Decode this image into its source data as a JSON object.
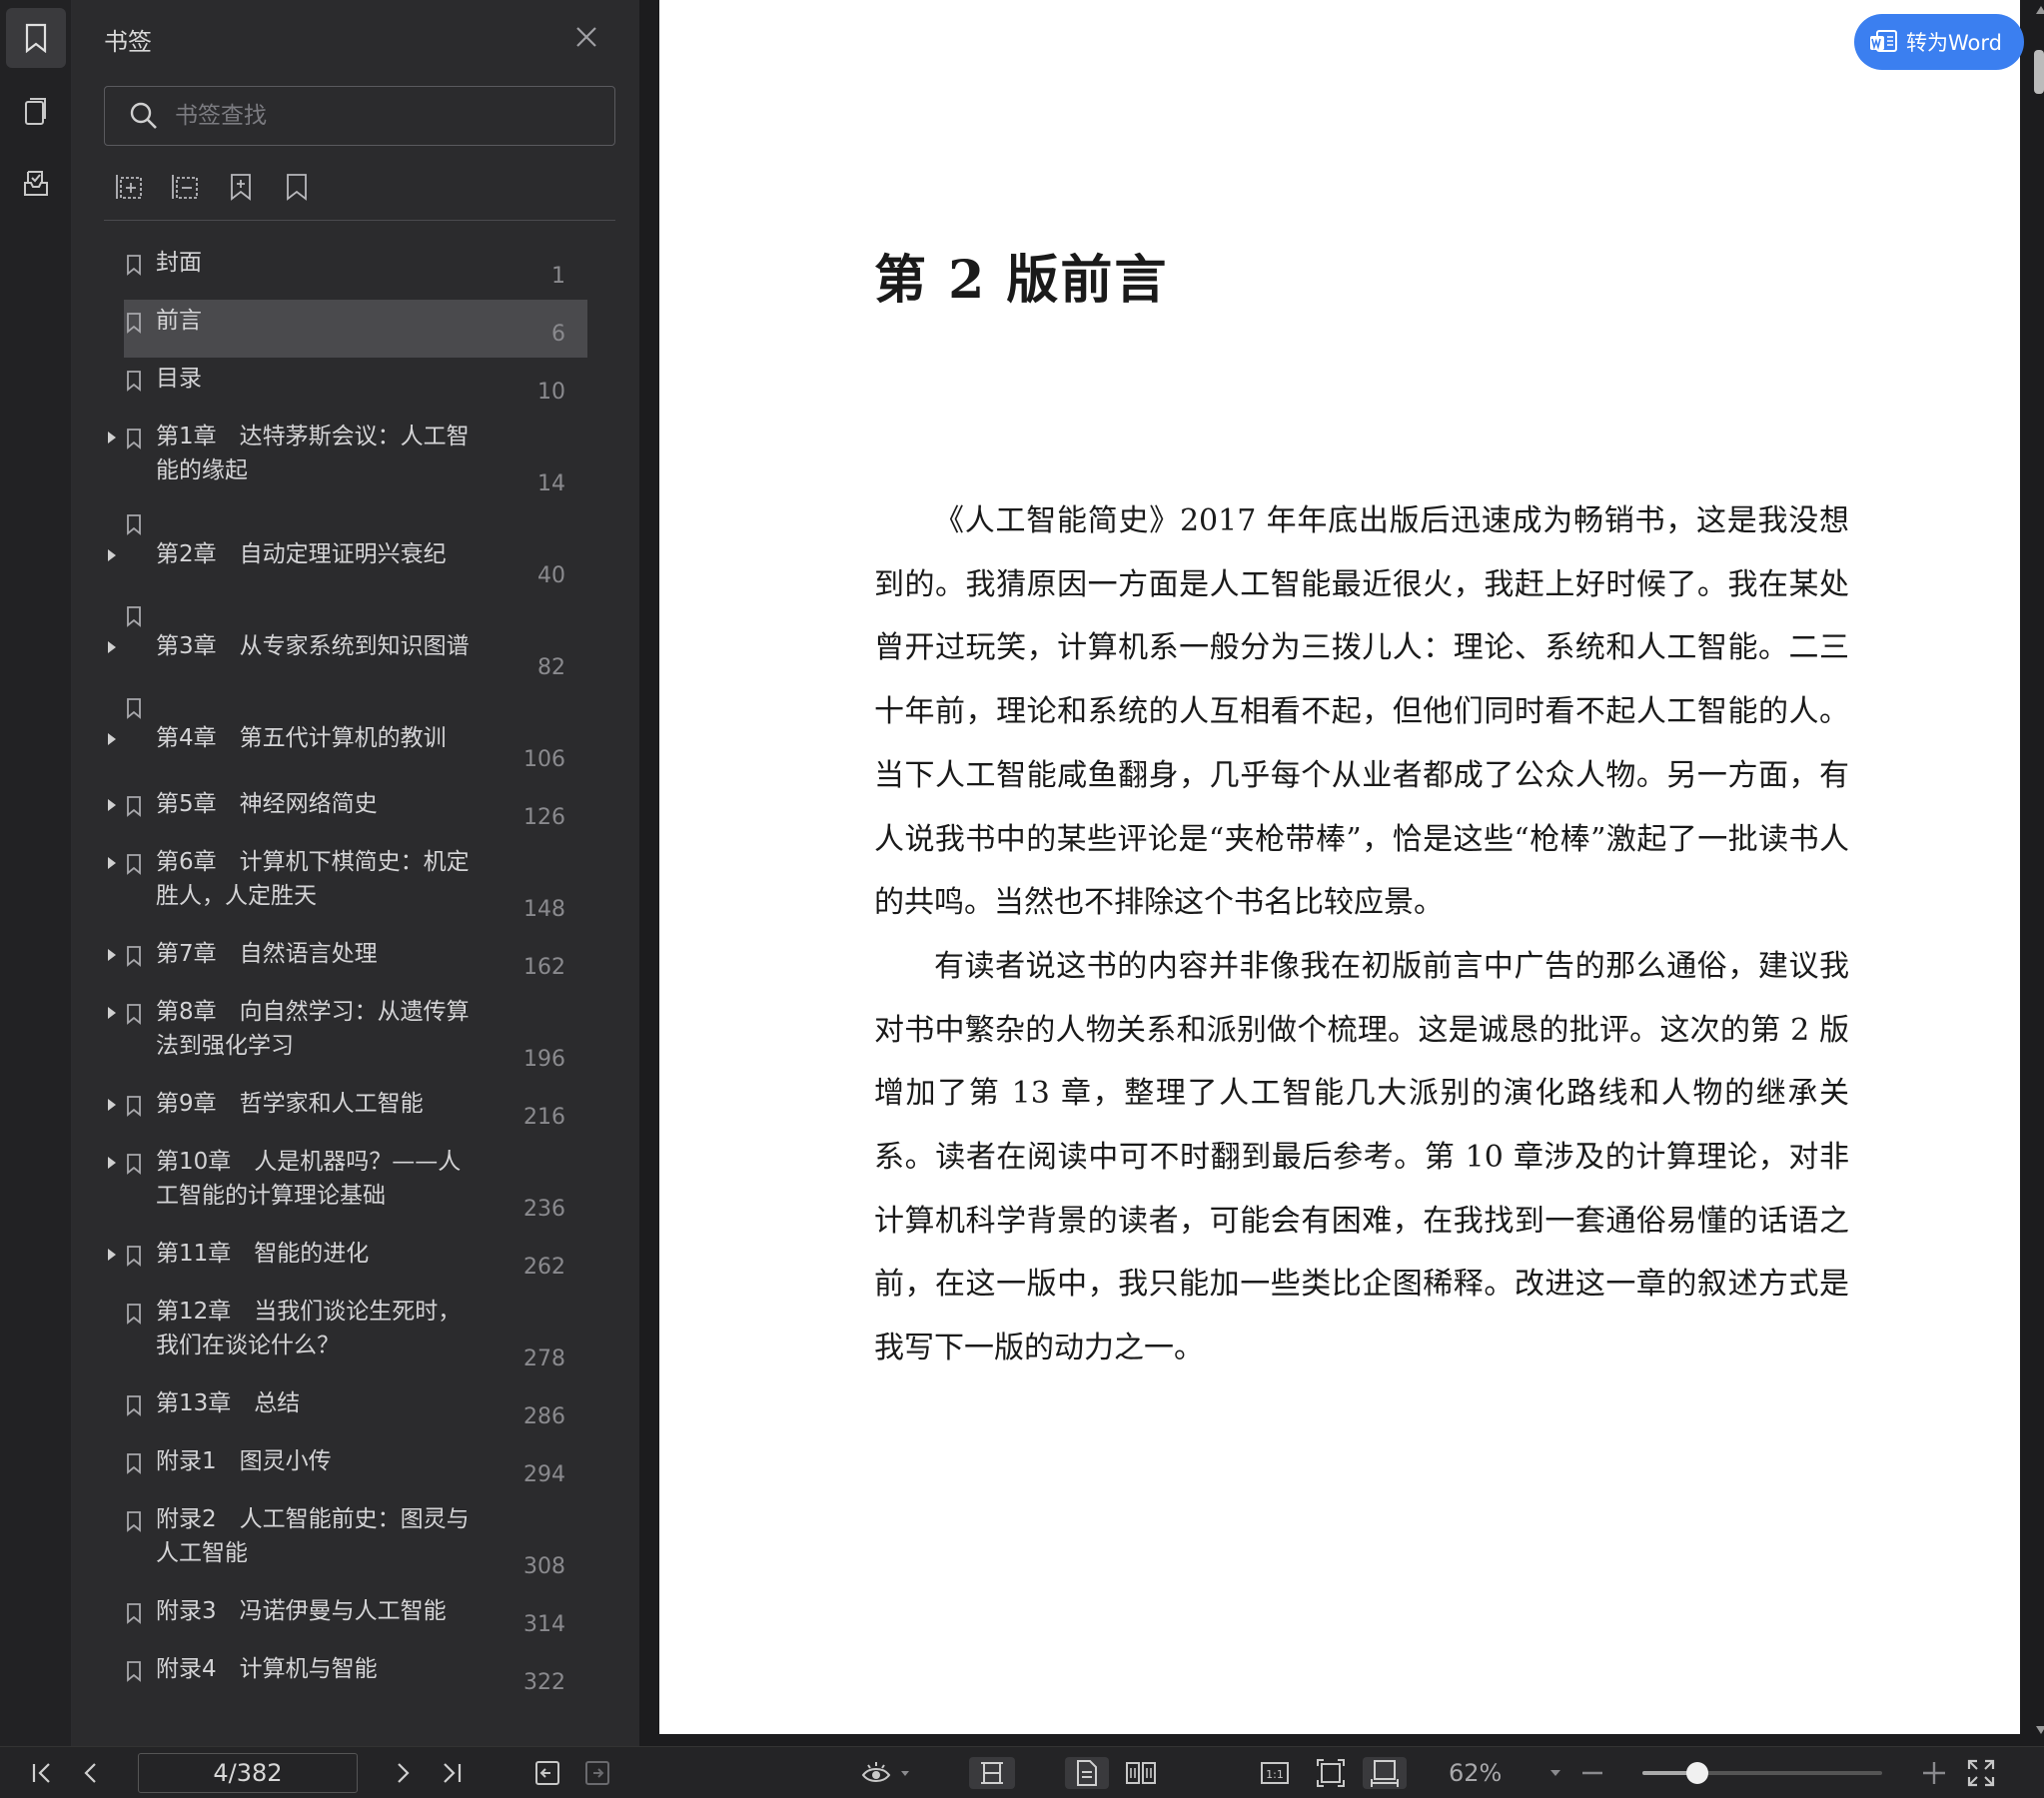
{
  "sidebar_panel": {
    "title": "书签",
    "search_placeholder": "书签查找",
    "bookmarks": [
      {
        "label": "封面",
        "page": "1",
        "expandable": false
      },
      {
        "label": "前言",
        "page": "6",
        "expandable": false,
        "selected": true
      },
      {
        "label": "目录",
        "page": "10",
        "expandable": false
      },
      {
        "label": "第1章　达特茅斯会议：人工智\n能的缘起",
        "page": "14",
        "expandable": true
      },
      {
        "label": "第2章　自动定理证明兴衰纪",
        "page": "40",
        "expandable": true
      },
      {
        "label": "第3章　从专家系统到知识图谱",
        "page": "82",
        "expandable": true
      },
      {
        "label": "第4章　第五代计算机的教训",
        "page": "106",
        "expandable": true
      },
      {
        "label": "第5章　神经网络简史",
        "page": "126",
        "expandable": true
      },
      {
        "label": "第6章　计算机下棋简史：机定\n胜人，人定胜天",
        "page": "148",
        "expandable": true
      },
      {
        "label": "第7章　自然语言处理",
        "page": "162",
        "expandable": true
      },
      {
        "label": "第8章　向自然学习：从遗传算\n法到强化学习",
        "page": "196",
        "expandable": true
      },
      {
        "label": "第9章　哲学家和人工智能",
        "page": "216",
        "expandable": true
      },
      {
        "label": "第10章　人是机器吗？——人\n工智能的计算理论基础",
        "page": "236",
        "expandable": true
      },
      {
        "label": "第11章　智能的进化",
        "page": "262",
        "expandable": true
      },
      {
        "label": "第12章　当我们谈论生死时，\n我们在谈论什么？",
        "page": "278",
        "expandable": false
      },
      {
        "label": "第13章　总结",
        "page": "286",
        "expandable": false
      },
      {
        "label": "附录1　图灵小传",
        "page": "294",
        "expandable": false
      },
      {
        "label": "附录2　人工智能前史：图灵与\n人工智能",
        "page": "308",
        "expandable": false
      },
      {
        "label": "附录3　冯诺伊曼与人工智能",
        "page": "314",
        "expandable": false
      },
      {
        "label": "附录4　计算机与智能",
        "page": "322",
        "expandable": false
      }
    ]
  },
  "document": {
    "convert_button": "转为Word",
    "heading": "第 2 版前言",
    "paragraphs": [
      "《人工智能简史》2017 年年底出版后迅速成为畅销书，这是我没想到的。我猜原因一方面是人工智能最近很火，我赶上好时候了。我在某处曾开过玩笑，计算机系一般分为三拨儿人：理论、系统和人工智能。二三十年前，理论和系统的人互相看不起，但他们同时看不起人工智能的人。当下人工智能咸鱼翻身，几乎每个从业者都成了公众人物。另一方面，有人说我书中的某些评论是“夹枪带棒”，恰是这些“枪棒”激起了一批读书人的共鸣。当然也不排除这个书名比较应景。",
      "有读者说这书的内容并非像我在初版前言中广告的那么通俗，建议我对书中繁杂的人物关系和派别做个梳理。这是诚恳的批评。这次的第 2 版增加了第 13 章，整理了人工智能几大派别的演化路线和人物的继承关系。读者在阅读中可不时翻到最后参考。第 10 章涉及的计算理论，对非计算机科学背景的读者，可能会有困难，在我找到一套通俗易懂的话语之前，在这一版中，我只能加一些类比企图稀释。改进这一章的叙述方式是我写下一版的动力之一。"
    ]
  },
  "bottom_bar": {
    "page_indicator": "4/382",
    "zoom": "62%",
    "zoom_slider_fraction": 0.23
  }
}
